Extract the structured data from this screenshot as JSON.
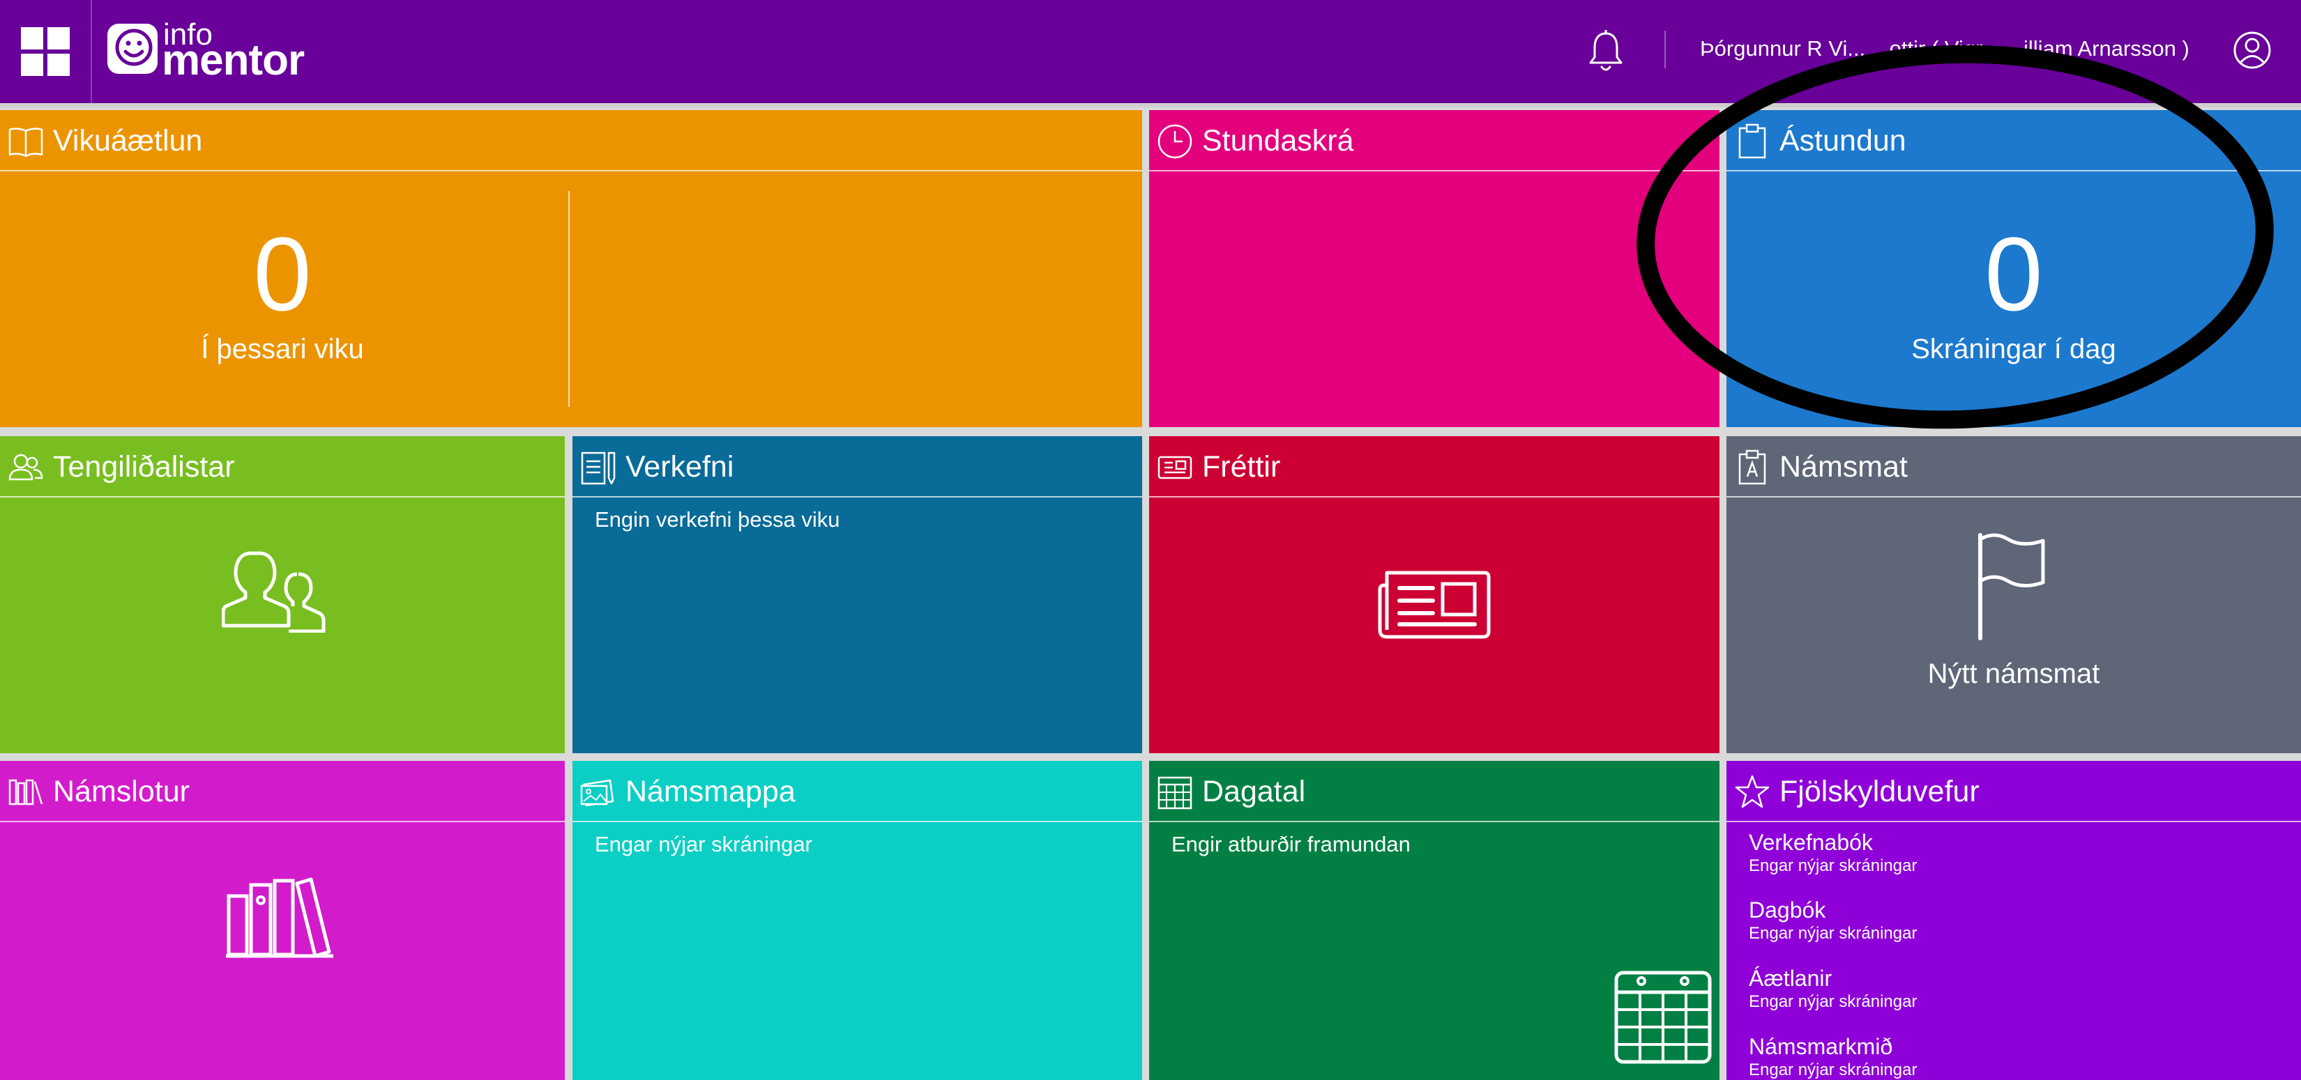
{
  "header": {
    "logo_small": "info",
    "logo_large": "mentor",
    "user_name": "Þórgunnur R Vi... ...ottir ( Vigr... ...illiam Arnarsson )"
  },
  "tiles": {
    "vikuaaetlun": {
      "title": "Vikuáætlun",
      "count": "0",
      "count_label": "Í þessari viku",
      "color": "#ec9400"
    },
    "stundaskra": {
      "title": "Stundaskrá",
      "color": "#e4007d"
    },
    "astundun": {
      "title": "Ástundun",
      "count": "0",
      "count_label": "Skráningar í dag",
      "color": "#1c79cd"
    },
    "tengilidalistar": {
      "title": "Tengiliðalistar",
      "color": "#79be20"
    },
    "verkefni": {
      "title": "Verkefni",
      "text": "Engin verkefni þessa viku",
      "color": "#096b97"
    },
    "frettir": {
      "title": "Fréttir",
      "color": "#cd0033"
    },
    "namsmat": {
      "title": "Námsmat",
      "action_label": "Nýtt námsmat",
      "color": "#5e6678"
    },
    "namslotur": {
      "title": "Námslotur",
      "color": "#d21ccc"
    },
    "namsmappa": {
      "title": "Námsmappa",
      "text": "Engar nýjar skráningar",
      "color": "#0bcfc5"
    },
    "dagatal": {
      "title": "Dagatal",
      "text": "Engir atburðir framundan",
      "color": "#028043"
    },
    "fjolskylduvefur": {
      "title": "Fjölskylduvefur",
      "color": "#8e00d7",
      "items": [
        {
          "title": "Verkefnabók",
          "sub": "Engar nýjar skráningar"
        },
        {
          "title": "Dagbók",
          "sub": "Engar nýjar skráningar"
        },
        {
          "title": "Áætlanir",
          "sub": "Engar nýjar skráningar"
        },
        {
          "title": "Námsmarkmið",
          "sub": "Engar nýjar skráningar"
        }
      ]
    }
  },
  "colors": {
    "header": "#680099",
    "annotation": "#000000"
  }
}
